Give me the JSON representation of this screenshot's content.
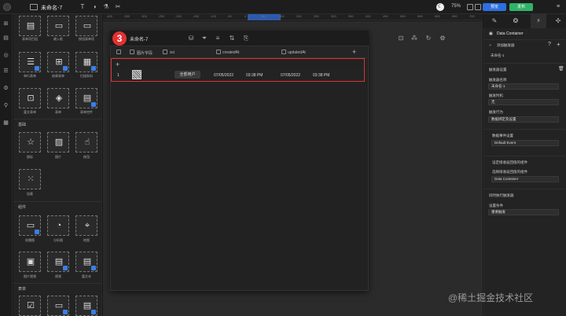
{
  "app": {
    "project_title": "未命名-7",
    "zoom": "75%"
  },
  "topbar": {
    "preview_label": "预览",
    "publish_label": "发布"
  },
  "panel": {
    "sections": [
      {
        "title": "",
        "items": [
          {
            "label": "表单项目组",
            "icon": "form-group-icon"
          },
          {
            "label": "输入框",
            "icon": "input-icon"
          },
          {
            "label": "按钮表单项",
            "icon": "button-field-icon"
          },
          {
            "label": "单行表单",
            "icon": "single-row-form-icon"
          },
          {
            "label": "结果表单",
            "icon": "result-form-icon"
          },
          {
            "label": "扫描条码",
            "icon": "barcode-icon"
          },
          {
            "label": "富文表单",
            "icon": "richtext-form-icon"
          },
          {
            "label": "表单",
            "icon": "form-icon"
          },
          {
            "label": "表单控件",
            "icon": "form-control-icon"
          }
        ]
      },
      {
        "title": "基础",
        "items": [
          {
            "label": "图标",
            "icon": "star-icon"
          },
          {
            "label": "图片",
            "icon": "image-icon"
          },
          {
            "label": "按钮",
            "icon": "button-icon"
          },
          {
            "label": "加载",
            "icon": "loading-icon"
          }
        ]
      },
      {
        "title": "组件",
        "items": [
          {
            "label": "轮播图",
            "icon": "carousel-icon"
          },
          {
            "label": "分析图",
            "icon": "pie-icon"
          },
          {
            "label": "地图",
            "icon": "map-icon"
          },
          {
            "label": "图片视频",
            "icon": "media-icon"
          },
          {
            "label": "视频",
            "icon": "video-icon"
          },
          {
            "label": "富文本",
            "icon": "richtext-icon"
          }
        ]
      },
      {
        "title": "表单",
        "items": [
          {
            "label": "",
            "icon": "checkbox-icon"
          },
          {
            "label": "",
            "icon": "textarea-icon"
          },
          {
            "label": "",
            "icon": "select-icon"
          }
        ]
      }
    ]
  },
  "ruler": {
    "ticks": [
      "-400",
      "-350",
      "-300",
      "-250",
      "-200",
      "-150",
      "-100",
      "-50",
      "0",
      "50",
      "100",
      "200",
      "250",
      "300",
      "350",
      "400",
      "450",
      "500",
      "550",
      "600",
      "650",
      "700"
    ]
  },
  "container": {
    "step": "3",
    "title": "未命名-7",
    "columns": [
      "图片字段",
      "sci",
      "createdAt",
      "updatedAt"
    ],
    "add_symbol": "+",
    "row": {
      "index": "1",
      "tag": "全部用户",
      "created_date": "07/05/2022",
      "created_time": "03:38 PM",
      "updated_date": "07/05/2022",
      "updated_time": "03:38 PM"
    }
  },
  "right_panel": {
    "component_name": "Data Container",
    "add_trigger_label": "添加触发器",
    "current_name": "未命名-1",
    "trigger_settings": "触发器设置",
    "trigger_name_label": "触发器名称",
    "trigger_name_value": "未命名-1",
    "trigger_time_label": "触发时机",
    "trigger_time_value": "无",
    "trigger_action_label": "触发行为",
    "trigger_action_value": "数据绑定及设置",
    "data_event_label": "数据事件设置",
    "data_event_value": "Default Event",
    "return_label": "设定接收返回值的组件",
    "return_select_label": "选择接收返回值的组件",
    "return_value": "Data Container",
    "sync_label": "同时执行触发器",
    "trigger_event_label": "设置条件",
    "trigger_event_value": "重要触发"
  },
  "watermark": "@稀土掘金技术社区"
}
